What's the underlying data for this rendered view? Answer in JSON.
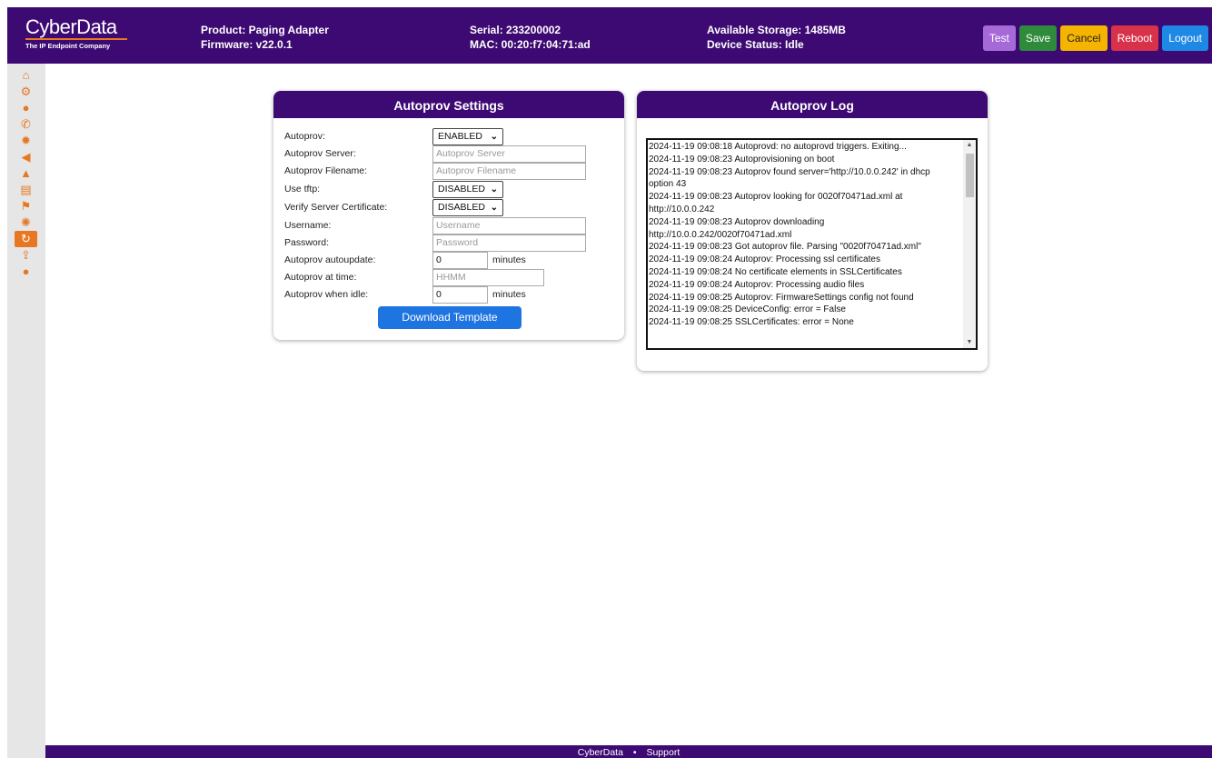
{
  "header": {
    "logo_main": "CyberData",
    "logo_sub": "The IP Endpoint Company",
    "product": "Product: Paging Adapter",
    "firmware": "Firmware: v22.0.1",
    "serial": "Serial: 233200002",
    "mac": "MAC: 00:20:f7:04:71:ad",
    "storage": "Available Storage: 1485MB",
    "status": "Device Status: Idle",
    "buttons": {
      "test": "Test",
      "save": "Save",
      "cancel": "Cancel",
      "reboot": "Reboot",
      "logout": "Logout"
    },
    "colors": {
      "header_bg": "#3d0a73",
      "accent": "#e87722"
    }
  },
  "sidebar": {
    "items": [
      {
        "icon": "home-icon",
        "glyph": "⌂"
      },
      {
        "icon": "gears-icon",
        "glyph": "⚙"
      },
      {
        "icon": "globe-icon",
        "glyph": "●"
      },
      {
        "icon": "phone-icon",
        "glyph": "✆"
      },
      {
        "icon": "sun-icon",
        "glyph": "✹"
      },
      {
        "icon": "bullhorn-icon",
        "glyph": "◀"
      },
      {
        "icon": "warning-icon",
        "glyph": "▲"
      },
      {
        "icon": "file-code-icon",
        "glyph": "▤"
      },
      {
        "icon": "flag-icon",
        "glyph": "⚑"
      },
      {
        "icon": "sunrise-icon",
        "glyph": "✺"
      },
      {
        "icon": "refresh-icon",
        "glyph": "↻",
        "active": true
      },
      {
        "icon": "upload-icon",
        "glyph": "⇪"
      },
      {
        "icon": "user-icon",
        "glyph": "●"
      }
    ]
  },
  "settings": {
    "title": "Autoprov Settings",
    "fields": {
      "autoprov": {
        "label": "Autoprov:",
        "value": "ENABLED"
      },
      "server": {
        "label": "Autoprov Server:",
        "placeholder": "Autoprov Server"
      },
      "filename": {
        "label": "Autoprov Filename:",
        "placeholder": "Autoprov Filename"
      },
      "tftp": {
        "label": "Use tftp:",
        "value": "DISABLED"
      },
      "verify_cert": {
        "label": "Verify Server Certificate:",
        "value": "DISABLED"
      },
      "username": {
        "label": "Username:",
        "placeholder": "Username"
      },
      "password": {
        "label": "Password:",
        "placeholder": "Password"
      },
      "autoupdate": {
        "label": "Autoprov autoupdate:",
        "value": "0",
        "suffix": "minutes"
      },
      "at_time": {
        "label": "Autoprov at time:",
        "placeholder": "HHMM"
      },
      "when_idle": {
        "label": "Autoprov when idle:",
        "value": "0",
        "suffix": "minutes"
      }
    },
    "download_label": "Download Template"
  },
  "log": {
    "title": "Autoprov Log",
    "lines": [
      "2024-11-19 09:08:18 Autoprovd: no autoprovd triggers.  Exiting...",
      "2024-11-19 09:08:23 Autoprovisioning on boot",
      "2024-11-19 09:08:23 Autoprov found server='http://10.0.0.242' in dhcp",
      "option 43",
      "2024-11-19 09:08:23 Autoprov looking for 0020f70471ad.xml at",
      "http://10.0.0.242",
      "2024-11-19 09:08:23 Autoprov downloading",
      "http://10.0.0.242/0020f70471ad.xml",
      "2024-11-19 09:08:23 Got autoprov file. Parsing \"0020f70471ad.xml\"",
      "2024-11-19 09:08:24 Autoprov: Processing ssl certificates",
      "2024-11-19 09:08:24 No certificate elements in SSLCertificates",
      "2024-11-19 09:08:24 Autoprov: Processing audio files",
      "2024-11-19 09:08:25 Autoprov: FirmwareSettings config not found",
      "2024-11-19 09:08:25 DeviceConfig: error = False",
      "2024-11-19 09:08:25 SSLCertificates: error = None"
    ]
  },
  "footer": {
    "left": "CyberData",
    "separator": "•",
    "right": "Support"
  }
}
